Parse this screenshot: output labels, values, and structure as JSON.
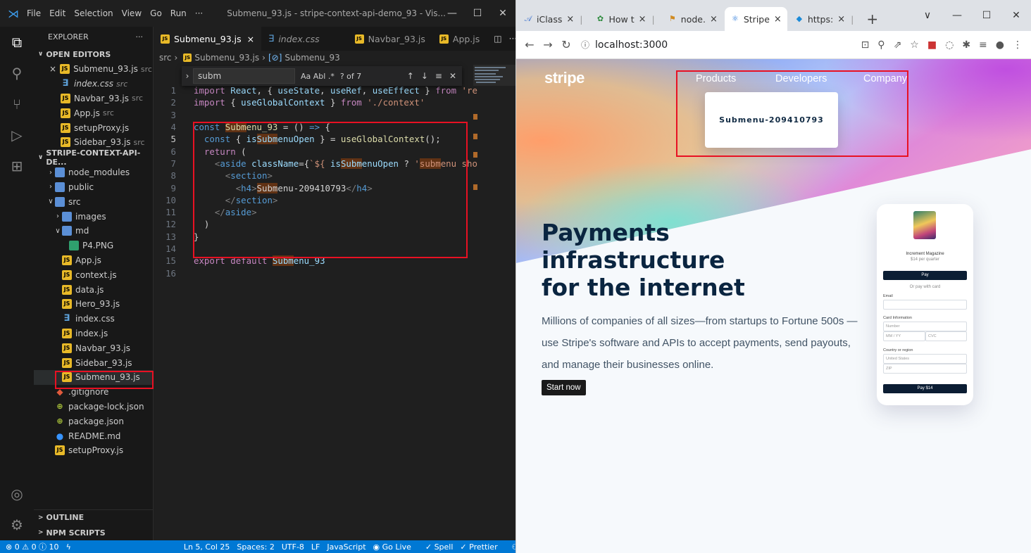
{
  "vscode": {
    "menu": [
      "File",
      "Edit",
      "Selection",
      "View",
      "Go",
      "Run",
      "···"
    ],
    "window_title": "Submenu_93.js - stripe-context-api-demo_93 - Vis...",
    "explorer_label": "EXPLORER",
    "explorer_more": "···",
    "open_editors_label": "OPEN EDITORS",
    "open_editors": [
      {
        "name": "Submenu_93.js",
        "note": "src",
        "type": "js",
        "close": "×"
      },
      {
        "name": "index.css",
        "note": "src",
        "type": "css"
      },
      {
        "name": "Navbar_93.js",
        "note": "src",
        "type": "js"
      },
      {
        "name": "App.js",
        "note": "src",
        "type": "js"
      },
      {
        "name": "setupProxy.js",
        "note": "",
        "type": "js"
      },
      {
        "name": "Sidebar_93.js",
        "note": "src",
        "type": "js"
      }
    ],
    "project_label": "STRIPE-CONTEXT-API-DE...",
    "tree": [
      {
        "name": "node_modules",
        "type": "folder"
      },
      {
        "name": "public",
        "type": "folder"
      },
      {
        "name": "src",
        "type": "folder"
      },
      {
        "name": "images",
        "type": "folder"
      },
      {
        "name": "md",
        "type": "folder"
      },
      {
        "name": "P4.PNG",
        "type": "png"
      },
      {
        "name": "App.js",
        "type": "js"
      },
      {
        "name": "context.js",
        "type": "js"
      },
      {
        "name": "data.js",
        "type": "js"
      },
      {
        "name": "Hero_93.js",
        "type": "js"
      },
      {
        "name": "index.css",
        "type": "css"
      },
      {
        "name": "index.js",
        "type": "js"
      },
      {
        "name": "Navbar_93.js",
        "type": "js"
      },
      {
        "name": "Sidebar_93.js",
        "type": "js"
      },
      {
        "name": "Submenu_93.js",
        "type": "js"
      },
      {
        "name": ".gitignore",
        "type": "git"
      },
      {
        "name": "package-lock.json",
        "type": "json"
      },
      {
        "name": "package.json",
        "type": "json"
      },
      {
        "name": "README.md",
        "type": "info"
      },
      {
        "name": "setupProxy.js",
        "type": "js"
      }
    ],
    "outline_label": "OUTLINE",
    "npm_label": "NPM SCRIPTS",
    "tabs": [
      {
        "name": "Submenu_93.js",
        "close": "×"
      },
      {
        "name": "index.css"
      },
      {
        "name": "Navbar_93.js"
      },
      {
        "name": "App.js"
      }
    ],
    "breadcrumb": {
      "folder": "src",
      "file": "Submenu_93.js",
      "symbol": "Submenu_93"
    },
    "find": {
      "query": "subm",
      "options": "Aa  Abl  .*",
      "count": "? of 7"
    },
    "line_numbers": [
      "1",
      "2",
      "3",
      "4",
      "5",
      "6",
      "7",
      "8",
      "9",
      "10",
      "11",
      "12",
      "13",
      "14",
      "15",
      "16"
    ],
    "status": {
      "problems": "⊗ 0 ⚠ 0 ⓘ 10",
      "position": "Ln 5, Col 25",
      "spaces": "Spaces: 2",
      "encoding": "UTF-8",
      "eol": "LF",
      "language": "JavaScript",
      "golive": "Go Live",
      "spell": "✓ Spell",
      "prettier": "Prettier"
    }
  },
  "chrome": {
    "tabs": [
      {
        "title": "iClass",
        "close": "×"
      },
      {
        "title": "How t",
        "close": "×"
      },
      {
        "title": "node.",
        "close": "×"
      },
      {
        "title": "Stripe",
        "close": "×"
      },
      {
        "title": "https:",
        "close": "×"
      }
    ],
    "new_tab": "+",
    "url": "localhost:3000"
  },
  "stripe": {
    "logo": "stripe",
    "nav": [
      "Products",
      "Developers",
      "Company"
    ],
    "submenu_title": "Submenu-209410793",
    "headline": [
      "Payments",
      "infrastructure",
      "for the internet"
    ],
    "lead": "Millions of companies of all sizes—from startups to Fortune 500s —use Stripe's software and APIs to accept payments, send payouts, and manage their businesses online.",
    "cta": "Start now",
    "phone": {
      "title": "Increment Magazine",
      "price": "$14 per quarter",
      "pay_button": " Pay",
      "or": "Or pay with card",
      "email_label": "Email",
      "card_label": "Card Information",
      "card_number": "Number",
      "expiry": "MM / YY",
      "cvc": "CVC",
      "country_label": "Country or region",
      "country": "United States",
      "zip": "ZIP",
      "submit": "Pay $14"
    }
  }
}
